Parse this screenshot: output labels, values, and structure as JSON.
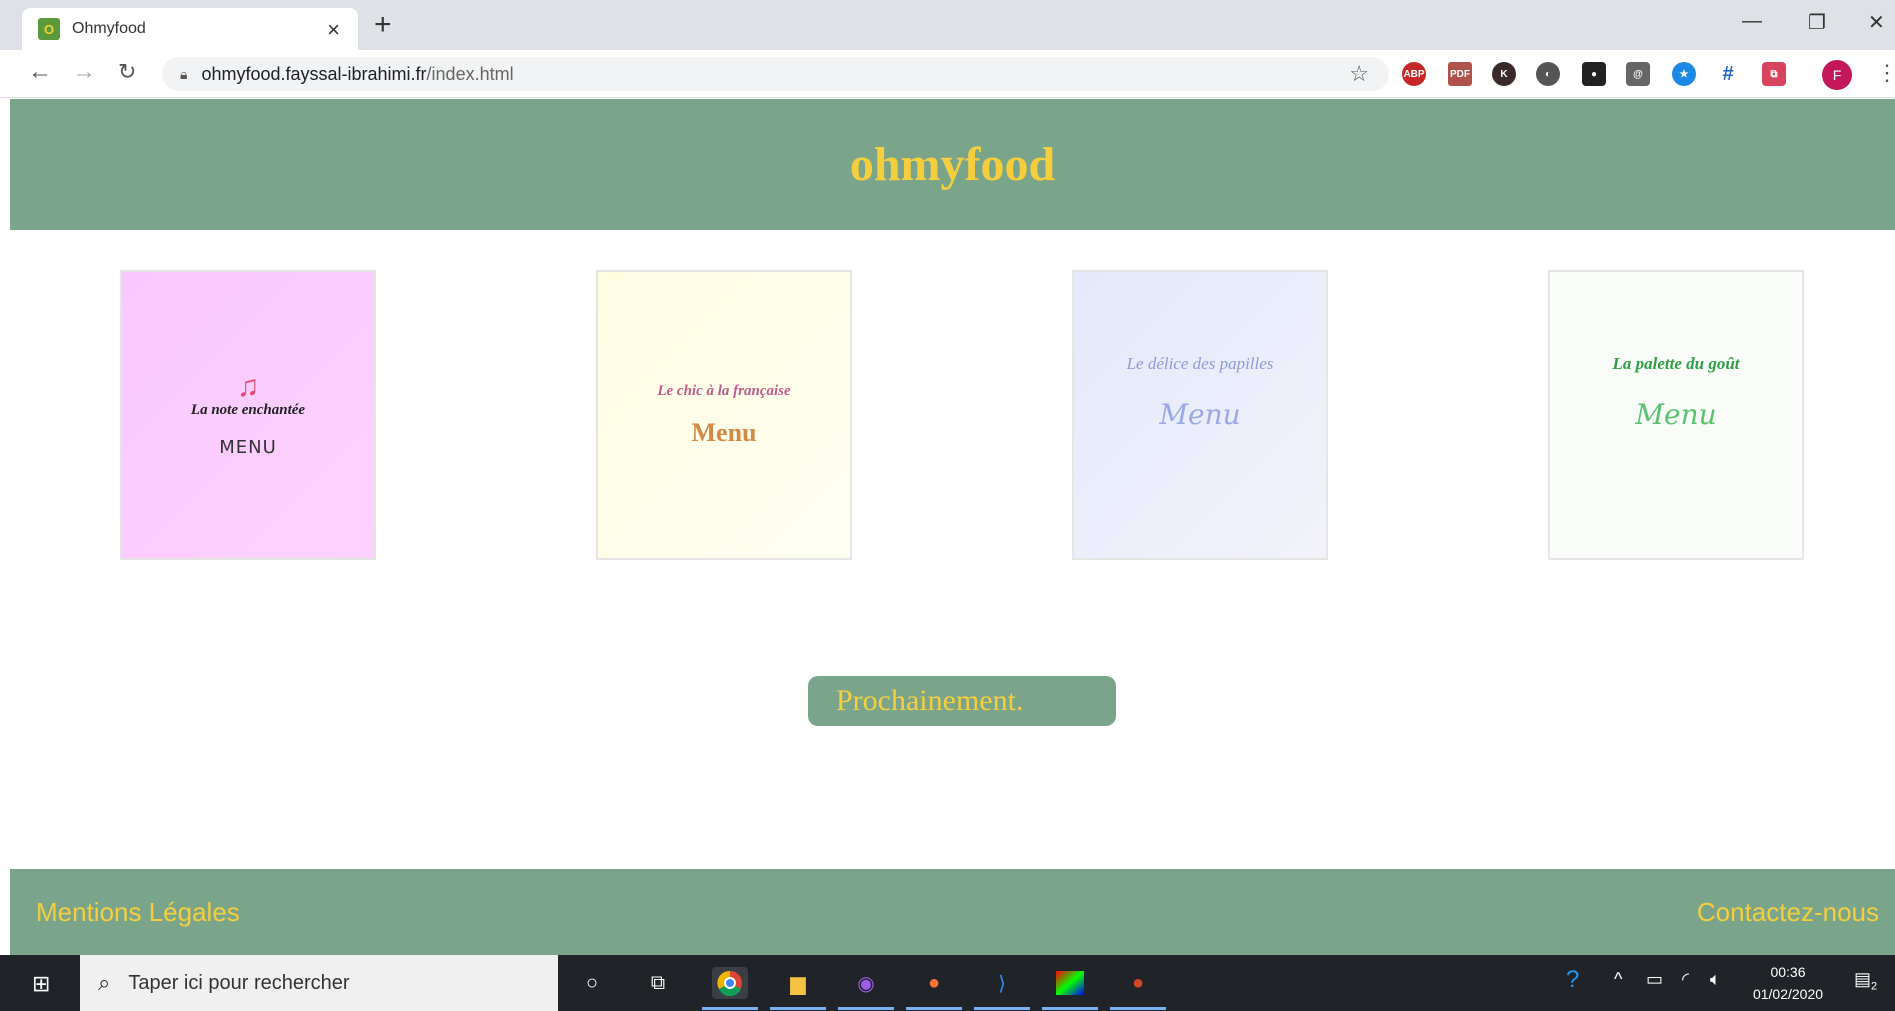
{
  "browser": {
    "tab_title": "Ohmyfood",
    "favicon_letter": "O",
    "url_host": "ohmyfood.fayssal-ibrahimi.fr",
    "url_path": "/index.html",
    "profile_initial": "F",
    "extensions": [
      "ABP",
      "PDF",
      "K",
      "◐",
      "●",
      "@",
      "★",
      "#",
      "⧉"
    ]
  },
  "site": {
    "brand": "ohmyfood",
    "restaurants": [
      {
        "name": "La note enchantée",
        "menu_label": "MENU"
      },
      {
        "name": "Le chic à la française",
        "menu_label": "Menu"
      },
      {
        "name": "Le délice des papilles",
        "menu_label": "Menu"
      },
      {
        "name": "La palette du goût",
        "menu_label": "Menu"
      }
    ],
    "coming_soon": "Prochainement.",
    "footer": {
      "left": "Mentions Légales",
      "right": "Contactez-nous"
    }
  },
  "taskbar": {
    "search_placeholder": "Taper ici pour rechercher",
    "time": "00:36",
    "date": "01/02/2020",
    "notifications": "2"
  }
}
